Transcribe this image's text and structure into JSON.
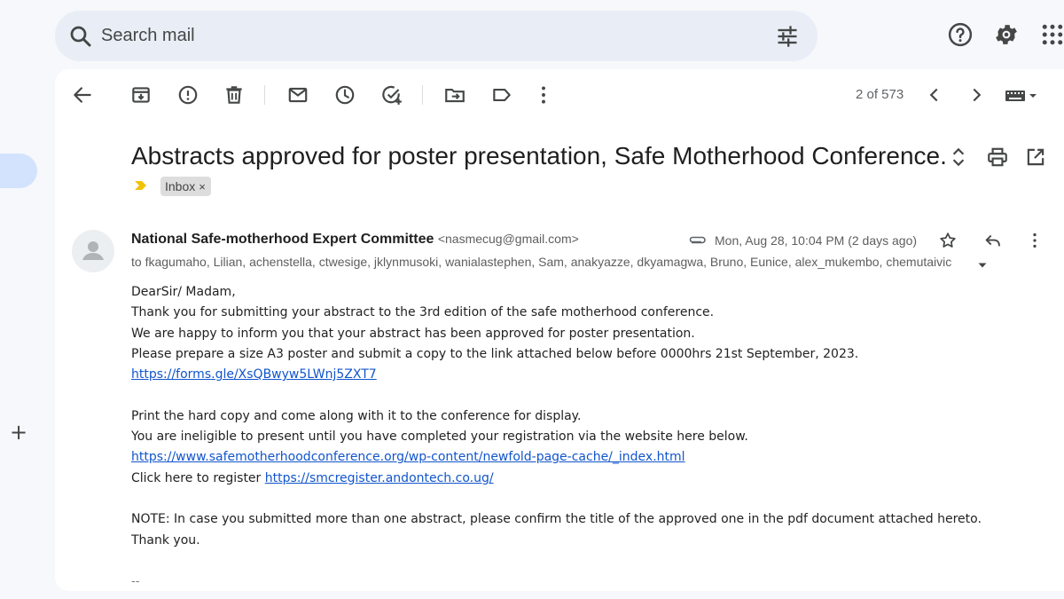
{
  "search": {
    "placeholder": "Search mail",
    "icons": [
      "search-icon",
      "tune-icon"
    ]
  },
  "header_icons": [
    "help-icon",
    "settings-icon",
    "apps-grid-icon"
  ],
  "toolbar": {
    "icons": [
      "back-icon",
      "archive-icon",
      "report-spam-icon",
      "delete-icon",
      "mark-unread-icon",
      "snooze-icon",
      "add-task-icon",
      "move-to-icon",
      "label-icon",
      "more-vert-icon"
    ],
    "counter": "2 of 573",
    "nav_icons": [
      "newer-icon",
      "older-icon",
      "input-tools-icon"
    ]
  },
  "message": {
    "subject": "Abstracts approved for poster presentation, Safe Motherhood Conference.",
    "label": "Inbox",
    "label_remove": "×",
    "sender_name": "National Safe-motherhood Expert Committee",
    "sender_email": "<nasmecug@gmail.com>",
    "date": "Mon, Aug 28, 10:04 PM (2 days ago)",
    "recipients": "to fkagumaho, Lilian, achenstella, ctwesige, jklynmusoki, wanialastephen, Sam, anakyazze, dkyamagwa, Bruno, Eunice, alex_mukembo, chemutaivic",
    "body": {
      "greeting": "DearSir/ Madam,",
      "line1": "Thank you for submitting your abstract to the 3rd edition of the safe motherhood conference.",
      "line2": "We are happy to inform you that your abstract has been approved for poster presentation.",
      "line3": "Please prepare a size A3 poster and submit a copy to the link attached below before 0000hrs 21st September, 2023.",
      "link1": "https://forms.gle/XsQBwyw5LWnj5ZXT7",
      "line4": "Print the hard copy and come along with it to the conference for display.",
      "line5": "You are ineligible to present until you have completed your registration via the website here below.",
      "link2": "https://www.safemotherhoodconference.org/wp-content/newfold-page-cache/_index.html",
      "register_prefix": "Click here to register",
      "link3": "https://smcregister.andontech.co.ug/",
      "note": "NOTE: In case you submitted more than one abstract, please confirm the title of the approved one in the pdf document attached hereto.",
      "thanks": "Thank you.",
      "signature": "--"
    }
  },
  "colors": {
    "accent_blue": "#d3e3fd",
    "search_bg": "#e9eef6",
    "importance": "#f2c200",
    "link": "#1155cc"
  }
}
